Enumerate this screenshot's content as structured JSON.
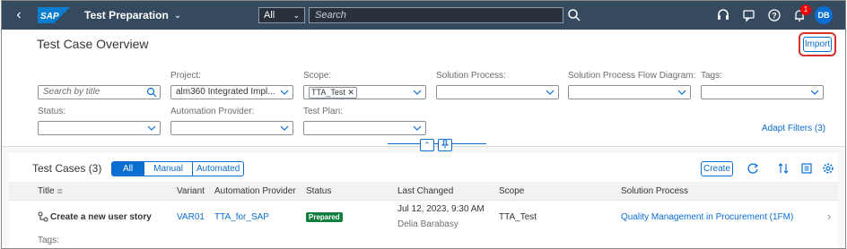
{
  "shell": {
    "app_title": "Test Preparation",
    "scope_value": "All",
    "search_placeholder": "Search",
    "notification_count": "1",
    "user_initials": "DB"
  },
  "header": {
    "title": "Test Case Overview",
    "import_label": "Import",
    "adapt_filters": "Adapt Filters (3)"
  },
  "filters": {
    "search_placeholder": "Search by title",
    "project_label": "Project:",
    "project_value": "alm360 Integrated Impl...",
    "scope_label": "Scope:",
    "scope_token": "TTA_Test",
    "solution_process_label": "Solution Process:",
    "flow_diagram_label": "Solution Process Flow Diagram:",
    "tags_label": "Tags:",
    "status_label": "Status:",
    "automation_provider_label": "Automation Provider:",
    "test_plan_label": "Test Plan:"
  },
  "table": {
    "title": "Test Cases (3)",
    "segments": [
      "All",
      "Manual",
      "Automated"
    ],
    "create_label": "Create",
    "columns": [
      "Title",
      "Variant",
      "Automation Provider",
      "Status",
      "Last Changed",
      "Scope",
      "Solution Process"
    ],
    "rows": [
      {
        "title": "Create a new user story",
        "variant": "VAR01",
        "automation_provider": "TTA_for_SAP",
        "status": "Prepared",
        "last_changed_date": "Jul 12, 2023, 9:30 AM",
        "last_changed_by": "Delia Barabasy",
        "scope": "TTA_Test",
        "solution_process": "Quality Management in Procurement (1FM)",
        "tags_label": "Tags:"
      }
    ]
  },
  "colors": {
    "shell_bg": "#354a5f",
    "accent": "#0a6ed1",
    "status_positive": "#107e3e",
    "highlight_ring": "#d9302c"
  }
}
